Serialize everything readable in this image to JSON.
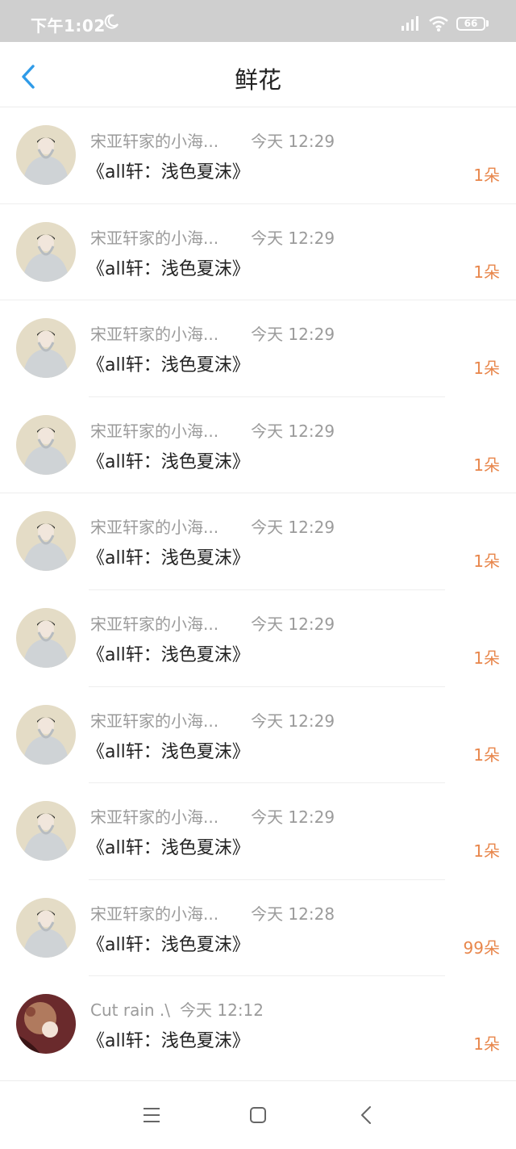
{
  "status_bar": {
    "time": "下午1:02",
    "battery": "66"
  },
  "header": {
    "title": "鲜花"
  },
  "rows": [
    {
      "name": "宋亚轩家的小海...",
      "time": "今天 12:29",
      "title": "《all轩：浅色夏沫》",
      "count": "1朵"
    },
    {
      "name": "宋亚轩家的小海...",
      "time": "今天 12:29",
      "title": "《all轩：浅色夏沫》",
      "count": "1朵"
    },
    {
      "name": "宋亚轩家的小海...",
      "time": "今天 12:29",
      "title": "《all轩：浅色夏沫》",
      "count": "1朵"
    },
    {
      "name": "宋亚轩家的小海...",
      "time": "今天 12:29",
      "title": "《all轩：浅色夏沫》",
      "count": "1朵"
    },
    {
      "name": "宋亚轩家的小海...",
      "time": "今天 12:29",
      "title": "《all轩：浅色夏沫》",
      "count": "1朵"
    },
    {
      "name": "宋亚轩家的小海...",
      "time": "今天 12:29",
      "title": "《all轩：浅色夏沫》",
      "count": "1朵"
    },
    {
      "name": "宋亚轩家的小海...",
      "time": "今天 12:29",
      "title": "《all轩：浅色夏沫》",
      "count": "1朵"
    },
    {
      "name": "宋亚轩家的小海...",
      "time": "今天 12:29",
      "title": "《all轩：浅色夏沫》",
      "count": "1朵"
    },
    {
      "name": "宋亚轩家的小海...",
      "time": "今天 12:28",
      "title": "《all轩：浅色夏沫》",
      "count": "99朵"
    },
    {
      "name": "Cut rain .\\",
      "time": "今天 12:12",
      "title": "《all轩：浅色夏沫》",
      "count": "1朵"
    }
  ],
  "colors": {
    "accent": "#2f9be8",
    "count": "#e8864b",
    "status_bar": "#cfcfcf"
  },
  "icons": {
    "back": "chevron-left-icon",
    "nav_menu": "menu-icon",
    "nav_home": "square-icon",
    "nav_back": "triangle-back-icon"
  }
}
